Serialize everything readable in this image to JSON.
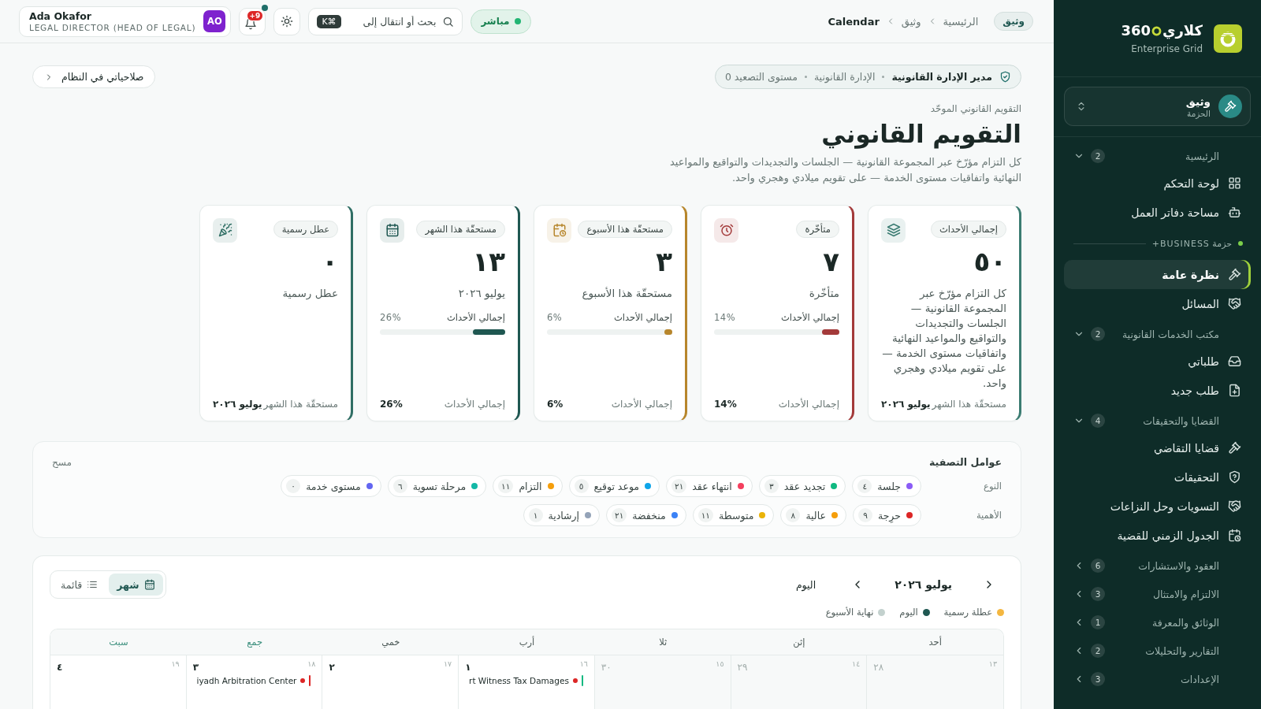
{
  "topbar": {
    "app_pill": "وثيق",
    "breadcrumbs": [
      "الرئيسية",
      "وثيق",
      "Calendar"
    ],
    "live": {
      "label": "مباشر",
      "on": true
    },
    "search": {
      "placeholder": "بحث أو انتقال إلى",
      "shortcut": "⌘K"
    },
    "notifications": {
      "badge": "+9",
      "unread_dot": true
    },
    "user": {
      "name": "Ada Okafor",
      "role": "LEGAL DIRECTOR (HEAD OF LEGAL)",
      "initials": "AO"
    }
  },
  "back_link": "صلاحياتي في النظام",
  "role_pill": {
    "title": "مدير الإدارة القانونية",
    "details": [
      "الإدارة القانونية",
      "مستوى التصعيد 0"
    ]
  },
  "header": {
    "eyebrow": "التقويم القانوني الموحّد",
    "title": "التقويم القانوني",
    "description": "كل التزام مؤرّخ عبر المجموعة القانونية — الجلسات والتجديدات والتواقيع والمواعيد النهائية واتفاقيات مستوى الخدمة — على تقويم ميلادي وهجري واحد."
  },
  "stat_cards": [
    {
      "chip": "إجمالي الأحداث",
      "color": "#3b7c72",
      "value": "٥٠",
      "caption": "كل التزام مؤرّخ عبر المجموعة القانونية — الجلسات والتجديدات والتواقيع والمواعيد النهائية واتفاقيات مستوى الخدمة — على تقويم ميلادي وهجري واحد.",
      "footer": {
        "label": "مستحقّة هذا الشهر",
        "value": "يوليو ٢٠٢٦"
      }
    },
    {
      "chip": "متأخّرة",
      "color": "#a33a3a",
      "value": "٧",
      "caption": "متأخّرة",
      "progress": {
        "label": "إجمالي الأحداث",
        "reading": "14%",
        "level": 0.14
      },
      "footer": {
        "label": "إجمالي الأحداث",
        "value": "14%"
      }
    },
    {
      "chip": "مستحقّة هذا الأسبوع",
      "color": "#b7862c",
      "value": "٣",
      "caption": "مستحقّة هذا الأسبوع",
      "progress": {
        "label": "إجمالي الأحداث",
        "reading": "6%",
        "level": 0.06
      },
      "footer": {
        "label": "إجمالي الأحداث",
        "value": "6%"
      }
    },
    {
      "chip": "مستحقّة هذا الشهر",
      "color": "#1f5751",
      "value": "١٣",
      "caption": "يوليو ٢٠٢٦",
      "progress": {
        "label": "إجمالي الأحداث",
        "reading": "26%",
        "level": 0.26
      },
      "footer": {
        "label": "إجمالي الأحداث",
        "value": "26%"
      }
    },
    {
      "chip": "عطل رسمية",
      "color": "#2f6e64",
      "value": "٠",
      "caption": "عطل رسمية",
      "footer": {
        "label": "مستحقّة هذا الشهر",
        "value": "يوليو ٢٠٢٦"
      }
    }
  ],
  "filters": {
    "title": "عوامل التصفية",
    "clear": "مسح",
    "groups": [
      {
        "label": "النوع",
        "chips": [
          {
            "label": "جلسة",
            "count": "٤",
            "color": "#8b5cf6",
            "selected": false
          },
          {
            "label": "تجديد عقد",
            "count": "٣",
            "color": "#10b981",
            "selected": false
          },
          {
            "label": "انتهاء عقد",
            "count": "٢١",
            "color": "#f43f5e",
            "selected": false
          },
          {
            "label": "موعد توقيع",
            "count": "٥",
            "color": "#0ea5e9",
            "selected": false
          },
          {
            "label": "التزام",
            "count": "١١",
            "color": "#f59e0b",
            "selected": false
          },
          {
            "label": "مرحلة تسوية",
            "count": "٦",
            "color": "#14b8a6",
            "selected": false
          },
          {
            "label": "مستوى خدمة",
            "count": "٠",
            "color": "#6366f1",
            "selected": false
          }
        ]
      },
      {
        "label": "الأهمية",
        "chips": [
          {
            "label": "حرِجة",
            "count": "٩",
            "color": "#dc2626",
            "selected": false
          },
          {
            "label": "عالية",
            "count": "٨",
            "color": "#f59e0b",
            "selected": false
          },
          {
            "label": "متوسطة",
            "count": "١١",
            "color": "#eab308",
            "selected": false
          },
          {
            "label": "منخفضة",
            "count": "٢١",
            "color": "#3b82f6",
            "selected": false
          },
          {
            "label": "إرشادية",
            "count": "١",
            "color": "#94a3b8",
            "selected": false
          }
        ]
      }
    ]
  },
  "calendar": {
    "month": "يوليو ٢٠٢٦",
    "today_button": "اليوم",
    "views": [
      {
        "label": "شهر",
        "selected": true
      },
      {
        "label": "قائمة",
        "selected": false
      }
    ],
    "legend": [
      {
        "label": "عطلة رسمية",
        "color": "#f4b740"
      },
      {
        "label": "اليوم",
        "color": "#1f5751"
      },
      {
        "label": "نهاية الأسبوع",
        "color": "#c3d1ce"
      }
    ],
    "weekdays": [
      {
        "label": "أحد",
        "weekend": false
      },
      {
        "label": "إثن",
        "weekend": false
      },
      {
        "label": "ثلا",
        "weekend": false
      },
      {
        "label": "أرب",
        "weekend": false
      },
      {
        "label": "خمي",
        "weekend": false
      },
      {
        "label": "جمع",
        "weekend": true
      },
      {
        "label": "سبت",
        "weekend": true
      }
    ],
    "days": [
      {
        "day": "٢٨",
        "hijri": "١٣",
        "outside": true
      },
      {
        "day": "٢٩",
        "hijri": "١٤",
        "outside": true
      },
      {
        "day": "٣٠",
        "hijri": "١٥",
        "outside": true
      },
      {
        "day": "١",
        "hijri": "١٦",
        "outside": false,
        "events": [
          {
            "title": "rt Witness Tax Damages",
            "color": "#10b981",
            "importance": {
              "color": "#dc2626"
            }
          }
        ]
      },
      {
        "day": "٢",
        "hijri": "١٧",
        "outside": false
      },
      {
        "day": "٣",
        "hijri": "١٨",
        "outside": false,
        "events": [
          {
            "title": "iyadh Arbitration Center",
            "color": "#dc2626",
            "importance": {
              "color": "#dc2626"
            }
          }
        ]
      },
      {
        "day": "٤",
        "hijri": "١٩",
        "outside": false
      }
    ]
  },
  "sidebar": {
    "brand": {
      "name": "كلاري",
      "suffix": "360",
      "subtitle": "Enterprise Grid"
    },
    "workspace": {
      "name": "وثيق",
      "caption": "الحزمة"
    },
    "nav": [
      {
        "kind": "section",
        "label": "الرئيسية",
        "count": "2",
        "expanded": true,
        "children": [
          {
            "label": "لوحة التحكم",
            "selected": false
          },
          {
            "label": "مساحة دفاتر العمل",
            "selected": false
          }
        ]
      },
      {
        "kind": "package",
        "label": "حزمة BUSINESS+",
        "children": [
          {
            "label": "نظرة عامة",
            "selected": true
          },
          {
            "label": "المسائل",
            "selected": false
          }
        ]
      },
      {
        "kind": "section",
        "label": "مكتب الخدمات القانونية",
        "count": "2",
        "expanded": true,
        "children": [
          {
            "label": "طلباتي",
            "selected": false
          },
          {
            "label": "طلب جديد",
            "selected": false
          }
        ]
      },
      {
        "kind": "section",
        "label": "القضايا والتحقيقات",
        "count": "4",
        "expanded": true,
        "children": [
          {
            "label": "قضايا التقاضي",
            "selected": false
          },
          {
            "label": "التحقيقات",
            "selected": false
          },
          {
            "label": "التسويات وحل النزاعات",
            "selected": false
          },
          {
            "label": "الجدول الزمني للقضية",
            "selected": false
          }
        ]
      },
      {
        "kind": "section",
        "label": "العقود والاستشارات",
        "count": "6",
        "expanded": false
      },
      {
        "kind": "section",
        "label": "الالتزام والامتثال",
        "count": "3",
        "expanded": false
      },
      {
        "kind": "section",
        "label": "الوثائق والمعرفة",
        "count": "1",
        "expanded": false
      },
      {
        "kind": "section",
        "label": "التقارير والتحليلات",
        "count": "2",
        "expanded": false
      },
      {
        "kind": "section",
        "label": "الإعدادات",
        "count": "3",
        "expanded": false
      }
    ]
  }
}
